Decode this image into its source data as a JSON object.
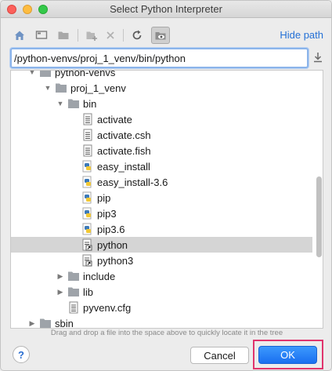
{
  "window": {
    "title": "Select Python Interpreter"
  },
  "toolbar": {
    "items": [
      {
        "icon": "home-icon"
      },
      {
        "icon": "desktop-icon"
      },
      {
        "icon": "project-folder-icon"
      },
      {
        "icon": "new-folder-icon"
      },
      {
        "icon": "delete-icon"
      },
      {
        "icon": "refresh-icon"
      },
      {
        "icon": "show-hidden-files-icon"
      }
    ],
    "hide_path_label": "Hide path"
  },
  "path": {
    "value": "/python-venvs/proj_1_venv/bin/python"
  },
  "tree": {
    "rows": [
      {
        "label": "python-venvs",
        "type": "folder",
        "arrow": "expanded"
      },
      {
        "label": "proj_1_venv",
        "type": "folder",
        "arrow": "expanded"
      },
      {
        "label": "bin",
        "type": "folder",
        "arrow": "expanded"
      },
      {
        "label": "activate",
        "type": "text-file",
        "arrow": "none"
      },
      {
        "label": "activate.csh",
        "type": "text-file",
        "arrow": "none"
      },
      {
        "label": "activate.fish",
        "type": "text-file",
        "arrow": "none"
      },
      {
        "label": "easy_install",
        "type": "python-file",
        "arrow": "none"
      },
      {
        "label": "easy_install-3.6",
        "type": "python-file",
        "arrow": "none"
      },
      {
        "label": "pip",
        "type": "python-file",
        "arrow": "none"
      },
      {
        "label": "pip3",
        "type": "python-file",
        "arrow": "none"
      },
      {
        "label": "pip3.6",
        "type": "python-file",
        "arrow": "none"
      },
      {
        "label": "python",
        "type": "executable-link",
        "arrow": "none",
        "selected": true
      },
      {
        "label": "python3",
        "type": "executable-link",
        "arrow": "none"
      },
      {
        "label": "include",
        "type": "folder",
        "arrow": "collapsed"
      },
      {
        "label": "lib",
        "type": "folder",
        "arrow": "collapsed"
      },
      {
        "label": "pyvenv.cfg",
        "type": "text-file",
        "arrow": "none"
      },
      {
        "label": "sbin",
        "type": "folder",
        "arrow": "collapsed"
      }
    ]
  },
  "hint": "Drag and drop a file into the space above to quickly locate it in the tree",
  "buttons": {
    "help": "?",
    "cancel": "Cancel",
    "ok": "OK"
  },
  "colors": {
    "accent": "#1a70f0",
    "link": "#2470d6",
    "highlight_box": "#e0356d"
  }
}
